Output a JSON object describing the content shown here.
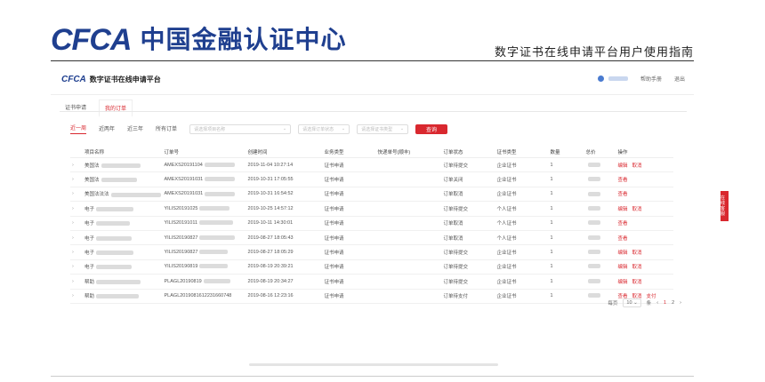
{
  "doc": {
    "logo_mark": "CFCA",
    "logo_cn": "中国金融认证中心",
    "guide_title": "数字证书在线申请平台用户使用指南"
  },
  "app": {
    "logo_mark": "CFCA",
    "logo_title": "数字证书在线申请平台",
    "help": "帮助手册",
    "logout": "退出"
  },
  "tabs": [
    "证书申请",
    "我的订单"
  ],
  "filters": {
    "ranges": [
      "近一周",
      "近两年",
      "近三年",
      "所有订单"
    ],
    "select_1": "请选择项目名称",
    "select_2": "请选择订单状态",
    "select_3": "请选择证书类型",
    "query": "查询"
  },
  "table": {
    "headers": [
      "项目名称",
      "订单号",
      "创建时间",
      "业务类型",
      "快递单号(顺丰)",
      "订单状态",
      "证书类型",
      "数量",
      "总价",
      "操作"
    ],
    "rows": [
      {
        "project": "美国法",
        "order_no": "AMEXS20191104",
        "time": "2019-11-04 10:27:14",
        "biz": "证书申请",
        "status": "订单待提交",
        "type": "企业证书",
        "qty": "1",
        "actions": [
          "编辑",
          "取消"
        ]
      },
      {
        "project": "美国法",
        "order_no": "AMEXS20191031",
        "time": "2019-10-31 17:05:55",
        "biz": "证书申请",
        "status": "订单关闭",
        "type": "企业证书",
        "qty": "1",
        "actions": [
          "查看"
        ]
      },
      {
        "project": "美国法法法",
        "order_no": "AMEXS20191031",
        "time": "2019-10-31 16:54:52",
        "biz": "证书申请",
        "status": "订单取消",
        "type": "企业证书",
        "qty": "1",
        "actions": [
          "查看"
        ]
      },
      {
        "project": "电子",
        "order_no": "YILIS20191025",
        "time": "2019-10-25 14:57:12",
        "biz": "证书申请",
        "status": "订单待提交",
        "type": "个人证书",
        "qty": "1",
        "actions": [
          "编辑",
          "取消"
        ]
      },
      {
        "project": "电子",
        "order_no": "YILIS20191011",
        "time": "2019-10-11 14:30:01",
        "biz": "证书申请",
        "status": "订单取消",
        "type": "个人证书",
        "qty": "1",
        "actions": [
          "查看"
        ]
      },
      {
        "project": "电子",
        "order_no": "YILIS20190827",
        "time": "2019-08-27 18:05:43",
        "biz": "证书申请",
        "status": "订单取消",
        "type": "个人证书",
        "qty": "1",
        "actions": [
          "查看"
        ]
      },
      {
        "project": "电子",
        "order_no": "YILIS20190827",
        "time": "2019-08-27 18:05:29",
        "biz": "证书申请",
        "status": "订单待提交",
        "type": "企业证书",
        "qty": "1",
        "actions": [
          "编辑",
          "取消"
        ]
      },
      {
        "project": "电子",
        "order_no": "YILIS20190819",
        "time": "2019-08-19 20:39:21",
        "biz": "证书申请",
        "status": "订单待提交",
        "type": "企业证书",
        "qty": "1",
        "actions": [
          "编辑",
          "取消"
        ]
      },
      {
        "project": "帮助",
        "order_no": "PLAGL20190819",
        "time": "2019-08-19 20:34:27",
        "biz": "证书申请",
        "status": "订单待提交",
        "type": "企业证书",
        "qty": "1",
        "actions": [
          "编辑",
          "取消"
        ]
      },
      {
        "project": "帮助",
        "order_no": "PLAGL2019081612231660748",
        "time": "2019-08-16 12:23:16",
        "biz": "证书申请",
        "status": "订单待支付",
        "type": "企业证书",
        "qty": "1",
        "actions": [
          "查看",
          "取消",
          "支付"
        ]
      }
    ]
  },
  "pager": {
    "per_page_label": "每页",
    "per_page": "10",
    "per_page_unit": "条",
    "prev": "‹",
    "pages": [
      "1",
      "2"
    ],
    "next": "›"
  },
  "side_tab": "在线客服",
  "colors": {
    "accent": "#d9282f",
    "brand": "#1f3f8f"
  }
}
